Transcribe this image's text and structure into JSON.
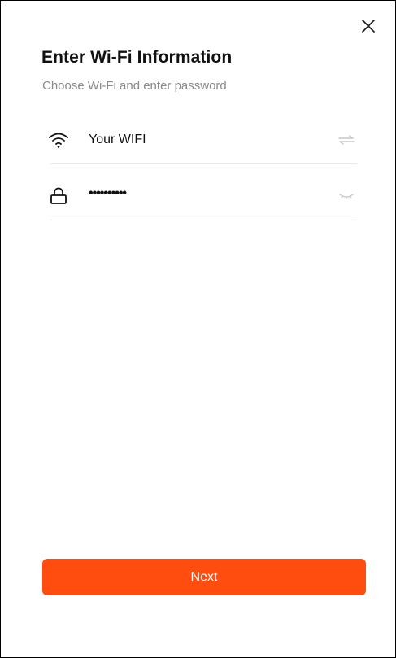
{
  "header": {
    "close_icon": "close-icon",
    "title": "Enter Wi-Fi Information",
    "subtitle": "Choose Wi-Fi and enter password"
  },
  "wifi_field": {
    "icon": "wifi-icon",
    "ssid": "Your WIFI",
    "switch_icon": "switch-network-icon"
  },
  "password_field": {
    "icon": "lock-icon",
    "value": "••••••••••",
    "toggle_icon": "eye-closed-icon"
  },
  "actions": {
    "next_label": "Next"
  },
  "colors": {
    "accent": "#ff4d10",
    "subtitle": "#8a8a8a",
    "divider": "#e8e8e8",
    "muted_icon": "#c8c8c8"
  }
}
